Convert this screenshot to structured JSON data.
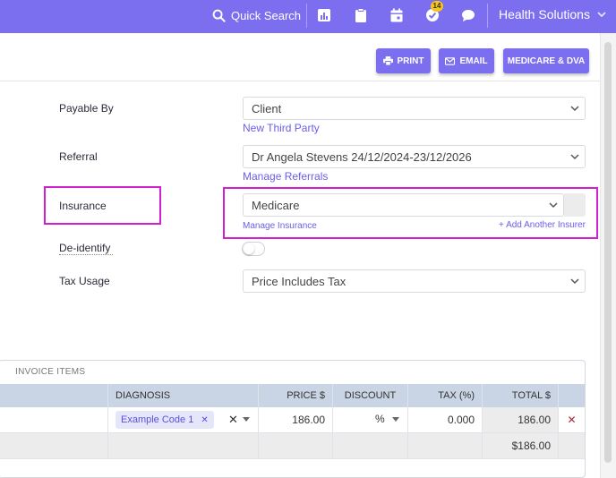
{
  "topbar": {
    "search_label": "Quick Search",
    "notifications_count": "14",
    "org_name": "Health Solutions",
    "icons": [
      "search-icon",
      "chart-icon",
      "clipboard-icon",
      "calendar-icon",
      "check-circle-icon",
      "chat-icon",
      "chevron-down-icon"
    ]
  },
  "toolbar": {
    "print_label": "PRINT",
    "email_label": "EMAIL",
    "medicare_label": "MEDICARE & DVA"
  },
  "form": {
    "payable_by": {
      "label": "Payable By",
      "value": "Client",
      "link": "New Third Party"
    },
    "referral": {
      "label": "Referral",
      "value": "Dr Angela Stevens 24/12/2024-23/12/2026",
      "link": "Manage Referrals"
    },
    "insurance": {
      "label": "Insurance",
      "value": "Medicare",
      "link": "Manage Insurance",
      "add_link": "+ Add Another Insurer"
    },
    "deidentify": {
      "label": "De-identify",
      "enabled": false
    },
    "tax_usage": {
      "label": "Tax Usage",
      "value": "Price Includes Tax"
    }
  },
  "invoice": {
    "title": "INVOICE ITEMS",
    "columns": {
      "diagnosis": "DIAGNOSIS",
      "price": "PRICE $",
      "discount": "DISCOUNT",
      "tax": "TAX (%)",
      "total": "TOTAL $"
    },
    "row": {
      "diagnosis_tag": "Example Code 1",
      "price": "186.00",
      "discount": "%",
      "tax": "0.000",
      "total": "186.00"
    },
    "grand_total": "$186.00"
  },
  "colors": {
    "accent": "#7b6ff0",
    "highlight": "#d21fd2",
    "header_bg": "#c9d5e5",
    "link": "#6a5ee8"
  }
}
